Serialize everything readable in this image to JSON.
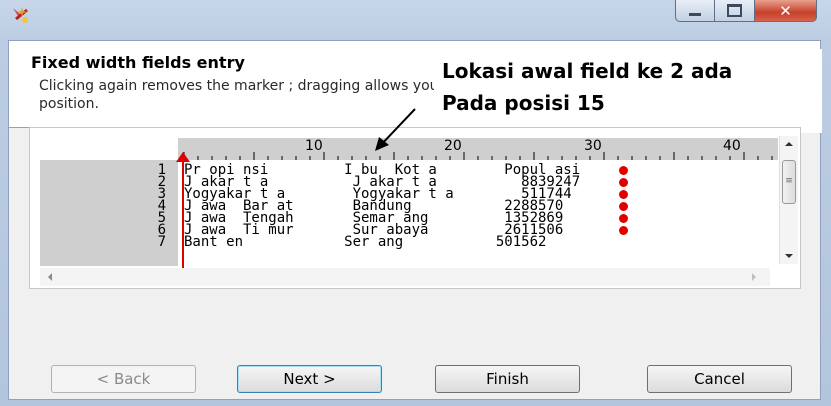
{
  "window": {
    "icon": "wand-icon",
    "minimize_icon": "minimize-icon",
    "maximize_icon": "maximize-icon",
    "close_glyph": "✕"
  },
  "header": {
    "title": "Fixed width fields entry",
    "description": "Clicking again removes the marker ; dragging allows you to position."
  },
  "callout": {
    "line1": "Lokasi awal field ke 2 ada",
    "line2": "Pada posisi 15"
  },
  "ruler": {
    "ticks": [
      "10",
      "20",
      "30",
      "40"
    ]
  },
  "rows": [
    {
      "num": "1",
      "text": "Pr opi nsi         I bu  Kot a        Popul asi"
    },
    {
      "num": "2",
      "text": "J akar t a          J akar t a          8839247"
    },
    {
      "num": "3",
      "text": "Yogyakar t a        Yogyakar t a        511744"
    },
    {
      "num": "4",
      "text": "J awa  Bar at       Bandung           2288570"
    },
    {
      "num": "5",
      "text": "J awa  Tengah       Semar ang         1352869"
    },
    {
      "num": "6",
      "text": "J awa  Ti mur       Sur abaya         2611506"
    },
    {
      "num": "7",
      "text": "Bant en            Ser ang           501562"
    }
  ],
  "buttons": {
    "back": "< Back",
    "next": "Next >",
    "finish": "Finish",
    "cancel": "Cancel"
  },
  "colors": {
    "marker": "#e00000",
    "default_button_border": "#3c7fb1"
  }
}
